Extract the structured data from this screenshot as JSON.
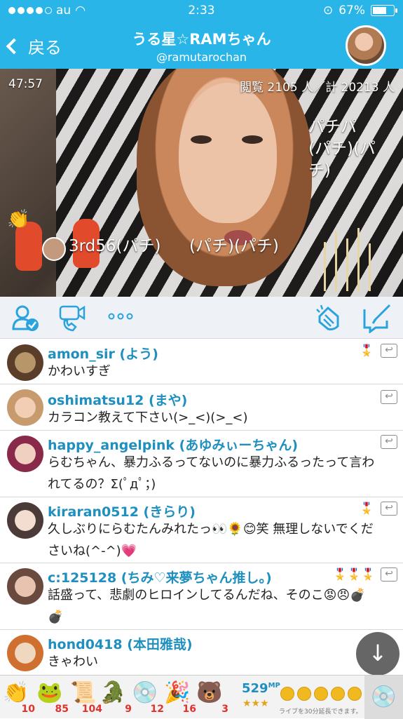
{
  "status_bar": {
    "carrier": "au",
    "time": "2:33",
    "battery": "67%"
  },
  "nav": {
    "back_label": "戻る",
    "title": "うる星☆RAMちゃん",
    "subtitle": "@ramutarochan"
  },
  "video": {
    "elapsed": "47:57",
    "views": "閲覧 2105 人／計 20213 人",
    "reaction_right": "パチパ\n(パチ)(パ\nチ)",
    "reaction_left": "3rd56(パチ)",
    "reaction_mid": "(パチ)(パチ)"
  },
  "comments": [
    {
      "user": "amon_sir (よう)",
      "text": "かわいすぎ",
      "badge": "🎖️"
    },
    {
      "user": "oshimatsu12 (まや)",
      "text": "カラコン教えて下さい(>_<)(>_<)"
    },
    {
      "user": "happy_angelpink (あゆみぃーちゃん)",
      "text": "らむちゃん、暴力ふるってないのに暴力ふるったって言われてるの？Σ(ﾟдﾟ；)"
    },
    {
      "user": "kiraran0512 (きらり)",
      "text": "久しぶりにらむたんみれたっ👀🌻😊笑 無理しないでくださいね(^-^)💗",
      "badge": "🎖️"
    },
    {
      "user": "c:125128 (ちみ♡来夢ちゃん推し。)",
      "text": "話盛って、悲劇のヒロインしてるんだね、そのこ😡😠💣💣",
      "badge": "🎖️🎖️🎖️"
    },
    {
      "user": "hond0418 (本田雅哉)",
      "text": "きゃわい"
    }
  ],
  "stamps": [
    {
      "icon": "clap-icon",
      "count": "10"
    },
    {
      "icon": "frog-icon",
      "count": "85"
    },
    {
      "icon": "scroll-icon",
      "count": "104"
    },
    {
      "icon": "frog-green-icon",
      "count": "9"
    },
    {
      "icon": "disc-icon",
      "count": "12"
    },
    {
      "icon": "party-icon",
      "count": "16"
    },
    {
      "icon": "bear-icon",
      "count": "3"
    }
  ],
  "mp": {
    "value": "529",
    "unit": "MP",
    "stars": "★★★",
    "note": "ライブを30分延長できます。"
  },
  "colors": {
    "accent": "#29b5e8",
    "name": "#1f8fbf"
  }
}
